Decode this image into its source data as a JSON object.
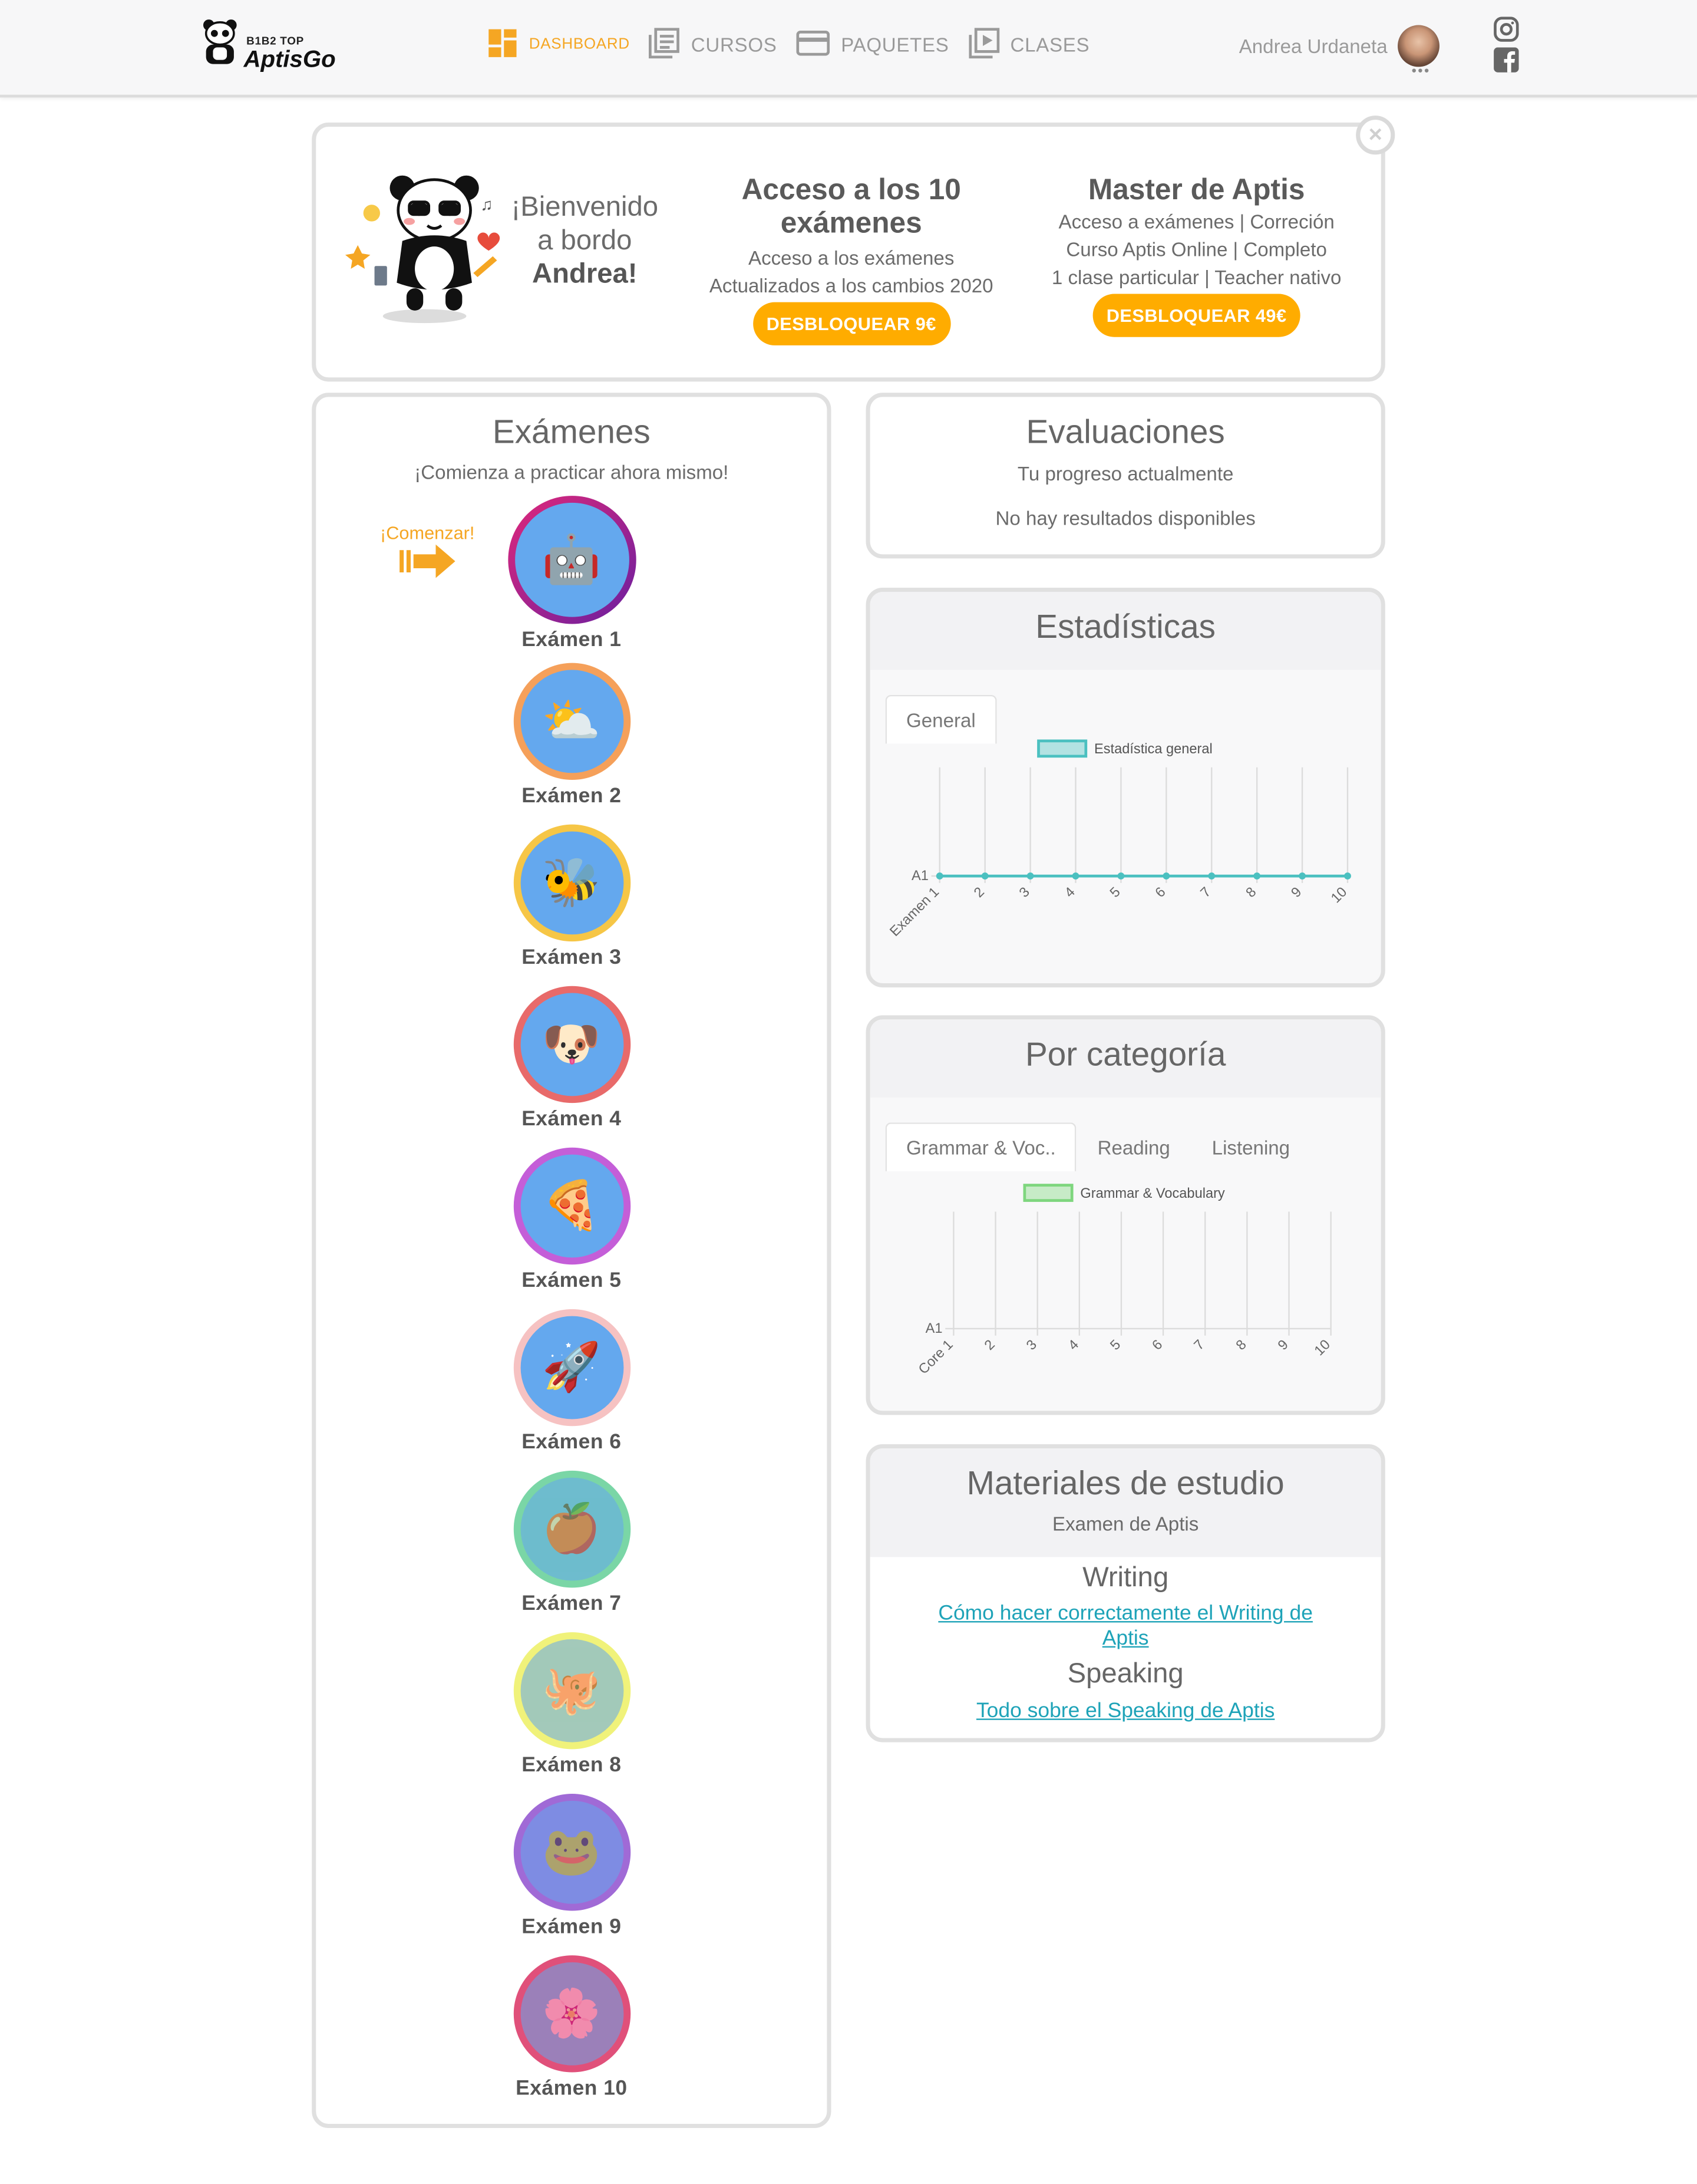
{
  "brand": {
    "top": "B1B2 TOP",
    "name": "AptisGo"
  },
  "nav": [
    {
      "label": "DASHBOARD",
      "icon": "dashboard-icon"
    },
    {
      "label": "CURSOS",
      "icon": "library-books-icon"
    },
    {
      "label": "PAQUETES",
      "icon": "credit-card-icon"
    },
    {
      "label": "CLASES",
      "icon": "video-library-icon"
    }
  ],
  "user": {
    "name": "Andrea Urdaneta",
    "more": "•••"
  },
  "welcome": {
    "greeting_1": "¡Bienvenido",
    "greeting_2": "a bordo",
    "name": "Andrea!",
    "offer1": {
      "title_1": "Acceso a los 10",
      "title_2": "exámenes",
      "desc_1": "Acceso a los exámenes",
      "desc_2": "Actualizados a los cambios 2020",
      "button": "DESBLOQUEAR 9€"
    },
    "offer2": {
      "title": "Master de Aptis",
      "desc_1": "Acceso a exámenes | Correción",
      "desc_2": "Curso Aptis Online | Completo",
      "desc_3": "1 clase particular | Teacher nativo",
      "button": "DESBLOQUEAR 49€"
    },
    "close": "×"
  },
  "exams": {
    "title": "Exámenes",
    "subtitle": "¡Comienza a practicar ahora mismo!",
    "start": "¡Comenzar!",
    "items": [
      {
        "label": "Exámen 1",
        "ring": "#e0287a",
        "icon": "robot-icon"
      },
      {
        "label": "Exámen 2",
        "ring": "#f5a05a",
        "icon": "sun-cloud-icon"
      },
      {
        "label": "Exámen 3",
        "ring": "#f6c646",
        "icon": "bee-icon"
      },
      {
        "label": "Exámen 4",
        "ring": "#e86a6a",
        "icon": "dog-icon"
      },
      {
        "label": "Exámen 5",
        "ring": "#c45ed8",
        "icon": "pizza-icon"
      },
      {
        "label": "Exámen 6",
        "ring": "#f6c2c2",
        "icon": "rocket-icon"
      },
      {
        "label": "Exámen 7",
        "ring": "#7ad6a6",
        "icon": "apple-icon"
      },
      {
        "label": "Exámen 8",
        "ring": "#f0f27a",
        "icon": "octopus-icon"
      },
      {
        "label": "Exámen 9",
        "ring": "#a06ad6",
        "icon": "frog-icon"
      },
      {
        "label": "Exámen 10",
        "ring": "#e0507a",
        "icon": "flower-icon"
      }
    ]
  },
  "evaluaciones": {
    "title": "Evaluaciones",
    "subtitle": "Tu progreso actualmente",
    "empty": "No hay resultados disponibles"
  },
  "estadisticas": {
    "title": "Estadísticas",
    "tab": "General"
  },
  "por_categoria": {
    "title": "Por categoría",
    "tabs": [
      "Grammar & Voc..",
      "Reading",
      "Listening"
    ]
  },
  "materiales": {
    "title": "Materiales de estudio",
    "subtitle": "Examen de Aptis",
    "writing_title": "Writing",
    "writing_link_1": "Cómo hacer correctamente el Writing de",
    "writing_link_2": "Aptis",
    "speaking_title": "Speaking",
    "speaking_link": "Todo sobre el Speaking de Aptis"
  },
  "chart_data": [
    {
      "type": "line",
      "title": "",
      "series": [
        {
          "name": "Estadística general",
          "values": [
            "A1",
            "A1",
            "A1",
            "A1",
            "A1",
            "A1",
            "A1",
            "A1",
            "A1",
            "A1"
          ],
          "color": "#4bc0c0"
        }
      ],
      "categories": [
        "Examen 1",
        "2",
        "3",
        "4",
        "5",
        "6",
        "7",
        "8",
        "9",
        "10"
      ],
      "y_ticks": [
        "A1"
      ],
      "grid": "vertical",
      "legend": "top"
    },
    {
      "type": "bar",
      "title": "",
      "series": [
        {
          "name": "Grammar & Vocabulary",
          "values": [],
          "color": "#7ed67e"
        }
      ],
      "categories": [
        "Core 1",
        "2",
        "3",
        "4",
        "5",
        "6",
        "7",
        "8",
        "9",
        "10"
      ],
      "y_ticks": [
        "A1"
      ],
      "grid": "vertical",
      "legend": "top"
    }
  ]
}
